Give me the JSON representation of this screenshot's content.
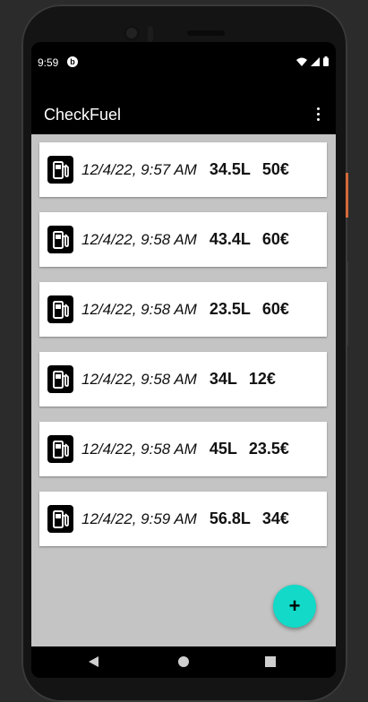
{
  "status_bar": {
    "time": "9:59",
    "app_icon_glyph": "b"
  },
  "app_bar": {
    "title": "CheckFuel"
  },
  "entries": [
    {
      "date": "12/4/22, 9:57 AM",
      "liters": "34.5L",
      "price": "50€"
    },
    {
      "date": "12/4/22, 9:58 AM",
      "liters": "43.4L",
      "price": "60€"
    },
    {
      "date": "12/4/22, 9:58 AM",
      "liters": "23.5L",
      "price": "60€"
    },
    {
      "date": "12/4/22, 9:58 AM",
      "liters": "34L",
      "price": "12€"
    },
    {
      "date": "12/4/22, 9:58 AM",
      "liters": "45L",
      "price": "23.5€"
    },
    {
      "date": "12/4/22, 9:59 AM",
      "liters": "56.8L",
      "price": "34€"
    }
  ],
  "fab": {
    "label": "+"
  },
  "colors": {
    "accent": "#12d9c8",
    "list_background": "#c4c4c4",
    "app_bar": "#000000"
  },
  "icons": {
    "entry": "fuel-pump-icon",
    "status": [
      "wifi-icon",
      "signal-icon",
      "battery-icon"
    ],
    "menu": "more-vert-icon",
    "nav": [
      "back-icon",
      "home-icon",
      "recents-icon"
    ]
  }
}
